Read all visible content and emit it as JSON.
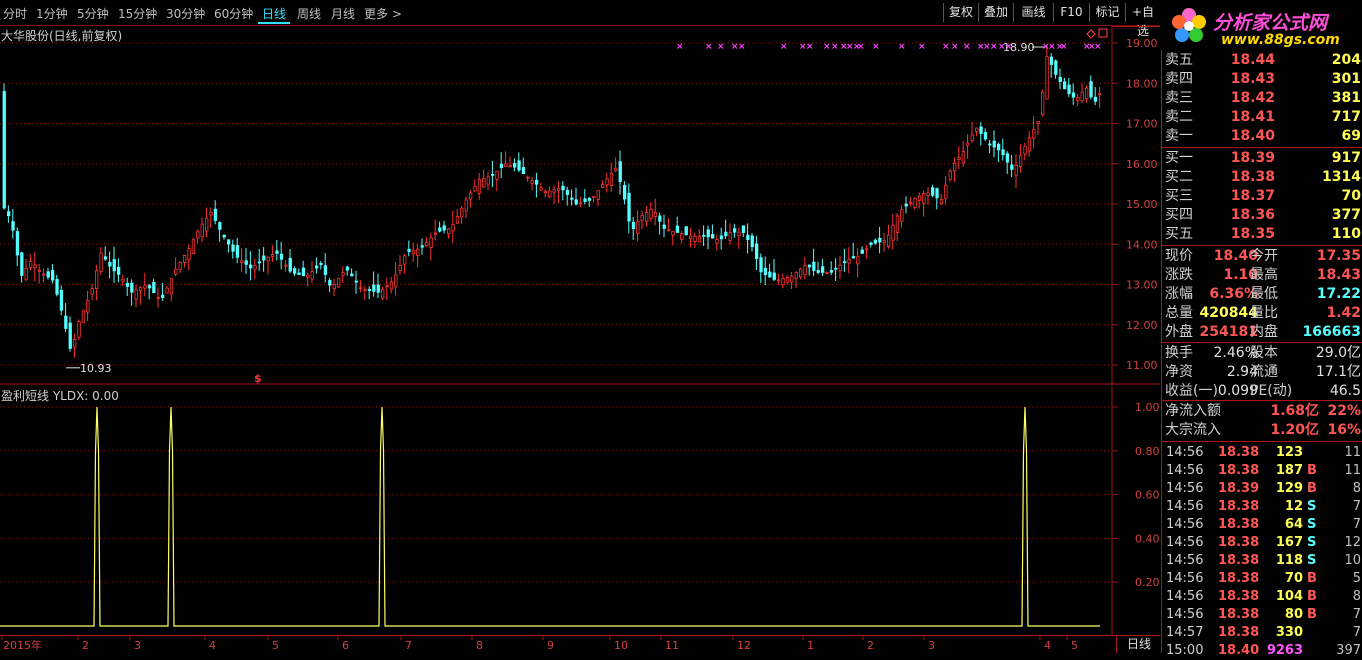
{
  "toolbar": {
    "timeframes": [
      "分时",
      "1分钟",
      "5分钟",
      "15分钟",
      "30分钟",
      "60分钟",
      "日线",
      "周线",
      "月线",
      "更多 >"
    ],
    "active": "日线",
    "buttons": [
      "复权",
      "叠加",
      "画线",
      "F10",
      "标记",
      "+自选"
    ]
  },
  "logo": {
    "title": "分析家公式网",
    "url": "www.88gs.com"
  },
  "main_chart": {
    "title": "大华股份(日线,前复权)",
    "price_ticks": [
      "19.00",
      "18.00",
      "17.00",
      "16.00",
      "15.00",
      "14.00",
      "13.00",
      "12.00",
      "11.00"
    ],
    "high_label": "18.90",
    "low_label": "10.93",
    "signal_marker": "$"
  },
  "indicator": {
    "title": "盈利短线 YLDX: 0.00",
    "ticks": [
      "1.00",
      "0.80",
      "0.60",
      "0.40",
      "0.20"
    ]
  },
  "x_axis": {
    "labels": [
      "2015年",
      "2",
      "3",
      "4",
      "5",
      "6",
      "7",
      "8",
      "9",
      "10",
      "11",
      "12",
      "1",
      "2",
      "3",
      "4",
      "5"
    ],
    "period_button": "日线"
  },
  "quotes": {
    "asks": [
      {
        "label": "卖五",
        "price": "18.44",
        "vol": "204"
      },
      {
        "label": "卖四",
        "price": "18.43",
        "vol": "301"
      },
      {
        "label": "卖三",
        "price": "18.42",
        "vol": "381"
      },
      {
        "label": "卖二",
        "price": "18.41",
        "vol": "717"
      },
      {
        "label": "卖一",
        "price": "18.40",
        "vol": "69"
      }
    ],
    "bids": [
      {
        "label": "买一",
        "price": "18.39",
        "vol": "917"
      },
      {
        "label": "买二",
        "price": "18.38",
        "vol": "1314"
      },
      {
        "label": "买三",
        "price": "18.37",
        "vol": "70"
      },
      {
        "label": "买四",
        "price": "18.36",
        "vol": "377"
      },
      {
        "label": "买五",
        "price": "18.35",
        "vol": "110"
      }
    ]
  },
  "stats": [
    {
      "l1": "现价",
      "v1": "18.40",
      "c1": "#ff5555",
      "l2": "今开",
      "v2": "17.35",
      "c2": "#ff5555"
    },
    {
      "l1": "涨跌",
      "v1": "1.10",
      "c1": "#ff5555",
      "l2": "最高",
      "v2": "18.43",
      "c2": "#ff5555"
    },
    {
      "l1": "涨幅",
      "v1": "6.36%",
      "c1": "#ff5555",
      "l2": "最低",
      "v2": "17.22",
      "c2": "#55ffff"
    },
    {
      "l1": "总量",
      "v1": "420844",
      "c1": "#ffff55",
      "l2": "量比",
      "v2": "1.42",
      "c2": "#ff5555"
    },
    {
      "l1": "外盘",
      "v1": "254181",
      "c1": "#ff5555",
      "l2": "内盘",
      "v2": "166663",
      "c2": "#55ffff"
    }
  ],
  "stats2": [
    {
      "l1": "换手",
      "v1": "2.46%",
      "c1": "#e0e0e0",
      "l2": "股本",
      "v2": "29.0亿",
      "c2": "#e0e0e0"
    },
    {
      "l1": "净资",
      "v1": "2.94",
      "c1": "#e0e0e0",
      "l2": "流通",
      "v2": "17.1亿",
      "c2": "#e0e0e0"
    },
    {
      "l1": "收益(一)",
      "v1": "0.099",
      "c1": "#e0e0e0",
      "l2": "PE(动)",
      "v2": "46.5",
      "c2": "#e0e0e0"
    }
  ],
  "flows": [
    {
      "label": "净流入额",
      "value": "1.68亿",
      "pct": "22%"
    },
    {
      "label": "大宗流入",
      "value": "1.20亿",
      "pct": "16%"
    }
  ],
  "trades": [
    {
      "time": "14:56",
      "price": "18.38",
      "vol": "123",
      "side": "",
      "n": "11"
    },
    {
      "time": "14:56",
      "price": "18.38",
      "vol": "187",
      "side": "B",
      "n": "11"
    },
    {
      "time": "14:56",
      "price": "18.39",
      "vol": "129",
      "side": "B",
      "n": "8"
    },
    {
      "time": "14:56",
      "price": "18.38",
      "vol": "12",
      "side": "S",
      "n": "7"
    },
    {
      "time": "14:56",
      "price": "18.38",
      "vol": "64",
      "side": "S",
      "n": "7"
    },
    {
      "time": "14:56",
      "price": "18.38",
      "vol": "167",
      "side": "S",
      "n": "12"
    },
    {
      "time": "14:56",
      "price": "18.38",
      "vol": "118",
      "side": "S",
      "n": "10"
    },
    {
      "time": "14:56",
      "price": "18.38",
      "vol": "70",
      "side": "B",
      "n": "5"
    },
    {
      "time": "14:56",
      "price": "18.38",
      "vol": "104",
      "side": "B",
      "n": "8"
    },
    {
      "time": "14:56",
      "price": "18.38",
      "vol": "80",
      "side": "B",
      "n": "7"
    },
    {
      "time": "14:57",
      "price": "18.38",
      "vol": "330",
      "side": "",
      "n": "7"
    },
    {
      "time": "15:00",
      "price": "18.40",
      "vol": "9263",
      "side": "",
      "n": "397"
    }
  ],
  "colors": {
    "up": "#ff3333",
    "down": "#55ffff",
    "grid": "#8a1515",
    "signal": "#ffff66",
    "cross": "#ff44ff"
  }
}
